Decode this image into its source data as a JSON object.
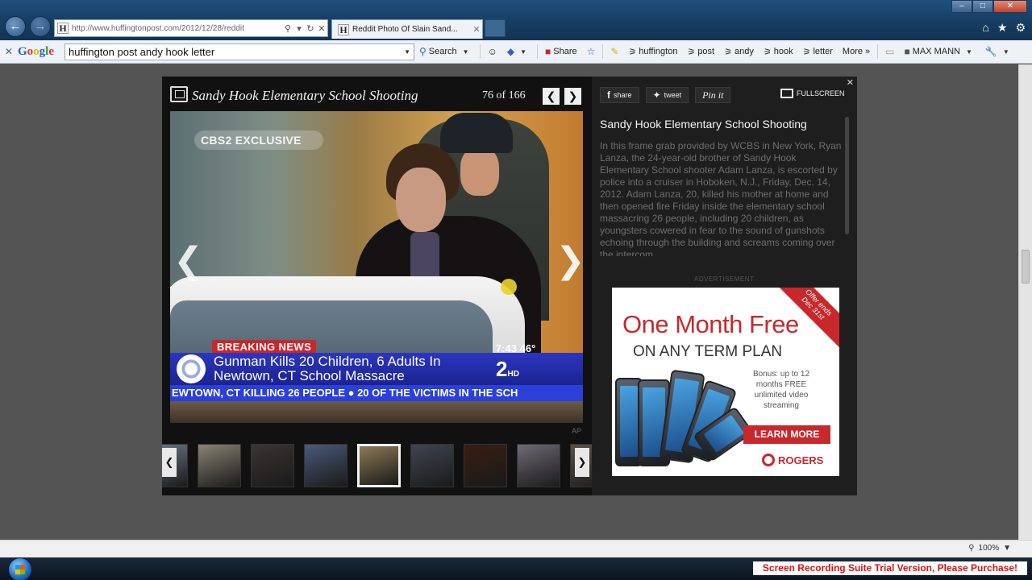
{
  "browser": {
    "address_url": "http://www.huffingtonpost.com/2012/12/28/reddit",
    "tab_title": "Reddit Photo Of Slain Sand...",
    "favicon_letter": "H"
  },
  "toolbar": {
    "search_value": "huffington post andy hook letter",
    "search_label": "Search",
    "share_label": "Share",
    "highlight_terms": [
      "huffington",
      "post",
      "andy",
      "hook",
      "letter"
    ],
    "more_label": "More",
    "user_label": "MAX MANN",
    "google_logo": [
      "G",
      "o",
      "o",
      "g",
      "l",
      "e"
    ]
  },
  "gallery": {
    "title": "Sandy Hook Elementary School Shooting",
    "counter": "76 of 166",
    "photo_credit": "AP",
    "photo": {
      "bug": "CBS2 EXCLUSIVE",
      "breaking": "BREAKING NEWS",
      "headline": "Gunman Kills 20 Children, 6 Adults In Newtown, CT School Massacre",
      "time_temp": "7:43  46°",
      "channel": "2",
      "channel_suffix": "HD",
      "ticker": "EWTOWN, CT KILLING 26 PEOPLE  ●  20 OF THE VICTIMS IN THE SCH"
    },
    "thumbnails": [
      {
        "active": false,
        "color": "#6d7a8a"
      },
      {
        "active": false,
        "color": "#8a8374"
      },
      {
        "active": false,
        "color": "#3b3434"
      },
      {
        "active": false,
        "color": "#4a5a7a"
      },
      {
        "active": true,
        "color": "#8c7a55"
      },
      {
        "active": false,
        "color": "#3f4550"
      },
      {
        "active": false,
        "color": "#3a1d12"
      },
      {
        "active": false,
        "color": "#6f6a74"
      },
      {
        "active": false,
        "color": "#5a5048"
      }
    ]
  },
  "side_panel": {
    "share": {
      "facebook": "share",
      "twitter": "tweet",
      "pinterest": "Pin it"
    },
    "fullscreen": "FULLSCREEN",
    "caption_title": "Sandy Hook Elementary School Shooting",
    "caption_text": "In this frame grab provided by WCBS in New York, Ryan Lanza, the 24-year-old brother of Sandy Hook Elementary School shooter Adam Lanza, is escorted by police into a cruiser in Hoboken, N.J., Friday, Dec. 14, 2012. Adam Lanza, 20, killed his mother at home and then opened fire Friday inside the elementary school massacring 26 people, including 20 children, as youngsters cowered in fear to the sound of gunshots echoing through the building and screams coming over the intercom.",
    "ad_label": "ADVERTISEMENT",
    "ad": {
      "offer": "Offer ends Dec 31st",
      "headline": "One Month Free",
      "subheadline": "ON ANY TERM PLAN",
      "bonus": "Bonus: up to 12 months FREE unlimited video streaming",
      "cta": "LEARN MORE",
      "brand": "ROGERS",
      "accent_color": "#c8282b"
    }
  },
  "status": {
    "zoom": "100%",
    "trial_banner": "Screen Recording Suite Trial Version, Please Purchase!"
  }
}
